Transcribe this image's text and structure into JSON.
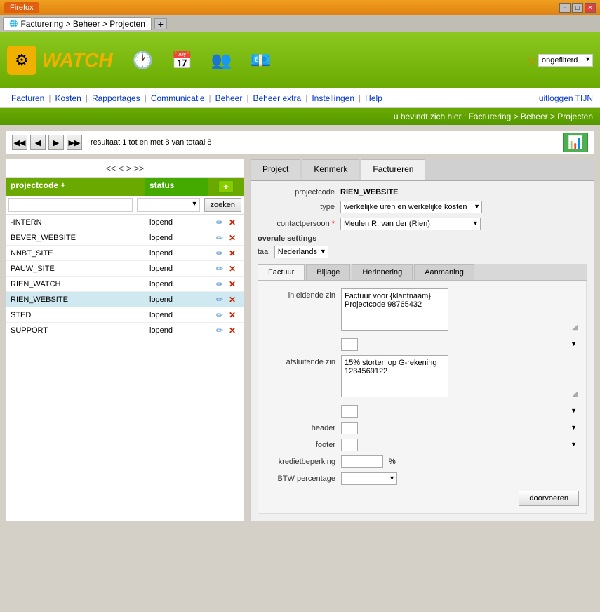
{
  "browser": {
    "title": "Firefox",
    "tab_label": "Facturering > Beheer > Projecten",
    "tab_add": "+",
    "win_min": "−",
    "win_max": "□",
    "win_close": "✕"
  },
  "app": {
    "logo_icon": "⚙",
    "logo_text": "WATCH",
    "filter_label": "ongefilterd",
    "filter_icon": "▽"
  },
  "nav": {
    "items": [
      "Facturen",
      "Kosten",
      "Rapportages",
      "Communicatie",
      "Beheer",
      "Beheer extra",
      "Instellingen",
      "Help"
    ],
    "logout_label": "uitloggen TIJN"
  },
  "breadcrumb": {
    "text": "u bevindt zich hier : Facturering > Beheer > Projecten"
  },
  "pagination": {
    "text": "resultaat 1 tot en met 8 van totaal 8"
  },
  "left_panel": {
    "nav_prev_prev": "<<",
    "nav_prev": "<",
    "nav_next": ">",
    "nav_next_next": ">>",
    "col_projectcode": "projectcode +",
    "col_status": "status",
    "search_placeholder": "",
    "zoeken_label": "zoeken",
    "rows": [
      {
        "code": "-INTERN",
        "status": "lopend"
      },
      {
        "code": "BEVER_WEBSITE",
        "status": "lopend"
      },
      {
        "code": "NNBT_SITE",
        "status": "lopend"
      },
      {
        "code": "PAUW_SITE",
        "status": "lopend"
      },
      {
        "code": "RIEN_WATCH",
        "status": "lopend"
      },
      {
        "code": "RIEN_WEBSITE",
        "status": "lopend"
      },
      {
        "code": "STED",
        "status": "lopend"
      },
      {
        "code": "SUPPORT",
        "status": "lopend"
      }
    ]
  },
  "right_panel": {
    "tabs": [
      "Project",
      "Kenmerk",
      "Factureren"
    ],
    "active_tab": "Factureren",
    "form": {
      "projectcode_label": "projectcode",
      "projectcode_value": "RIEN_WEBSITE",
      "type_label": "type",
      "type_value": "werkelijke uren en werkelijke kosten",
      "contactpersoon_label": "contactpersoon *",
      "contactpersoon_value": "Meulen R. van der (Rien)",
      "overule_title": "overule settings",
      "taal_label": "taal",
      "taal_value": "Nederlands"
    },
    "sub_tabs": [
      "Factuur",
      "Bijlage",
      "Herinnering",
      "Aanmaning"
    ],
    "active_sub_tab": "Factuur",
    "factuur": {
      "inleidende_label": "inleidende zin",
      "inleidende_value": "Factuur voor {klantnaam}\nProjectcode 98765432",
      "inleidende_select": "",
      "afsluitende_label": "afsluitende zin",
      "afsluitende_value": "15% storten op G-rekening\n1234569122",
      "afsluitende_select": "",
      "header_label": "header",
      "header_select": "",
      "footer_label": "footer",
      "footer_select": "",
      "krediet_label": "kredietbeperking",
      "krediet_value": "",
      "percent_label": "%",
      "btw_label": "BTW percentage",
      "btw_value": "",
      "doorvoeren_label": "doorvoeren"
    }
  }
}
